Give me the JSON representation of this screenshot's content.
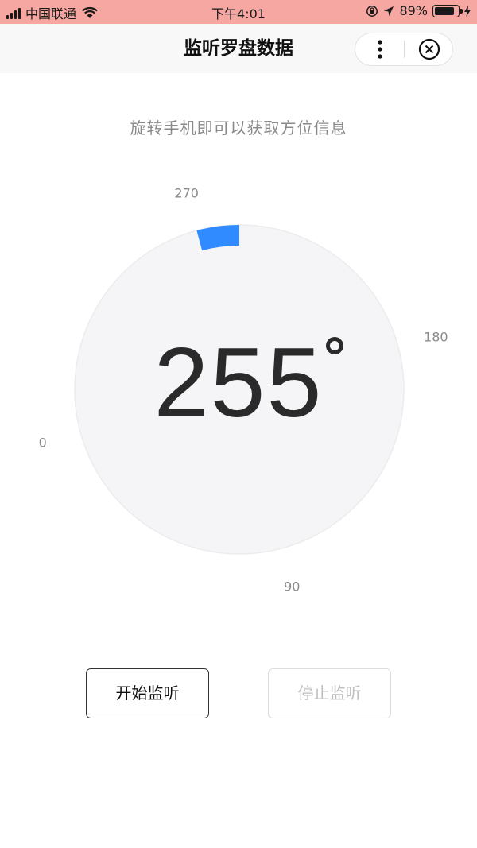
{
  "status_bar": {
    "carrier": "中国联通",
    "time": "下午4:01",
    "battery_percent": "89%",
    "battery_level": 0.89,
    "icons": [
      "signal-icon",
      "wifi-icon",
      "orientation-lock-icon",
      "location-icon",
      "battery-icon",
      "charging-icon"
    ]
  },
  "nav": {
    "title": "监听罗盘数据",
    "more_icon": "more-icon",
    "close_icon": "close-circle-icon"
  },
  "main": {
    "hint": "旋转手机即可以获取方位信息",
    "compass": {
      "value": "255",
      "heading_degrees": 255,
      "tick_labels": [
        {
          "label": "270",
          "angle": 270
        },
        {
          "label": "180",
          "angle": 180
        },
        {
          "label": "0",
          "angle": 0
        },
        {
          "label": "90",
          "angle": 90
        }
      ],
      "progress_color": "#2f8bff",
      "track_color": "#f5f5f7",
      "track_border_color": "#ececec"
    },
    "buttons": {
      "start_label": "开始监听",
      "stop_label": "停止监听"
    }
  }
}
